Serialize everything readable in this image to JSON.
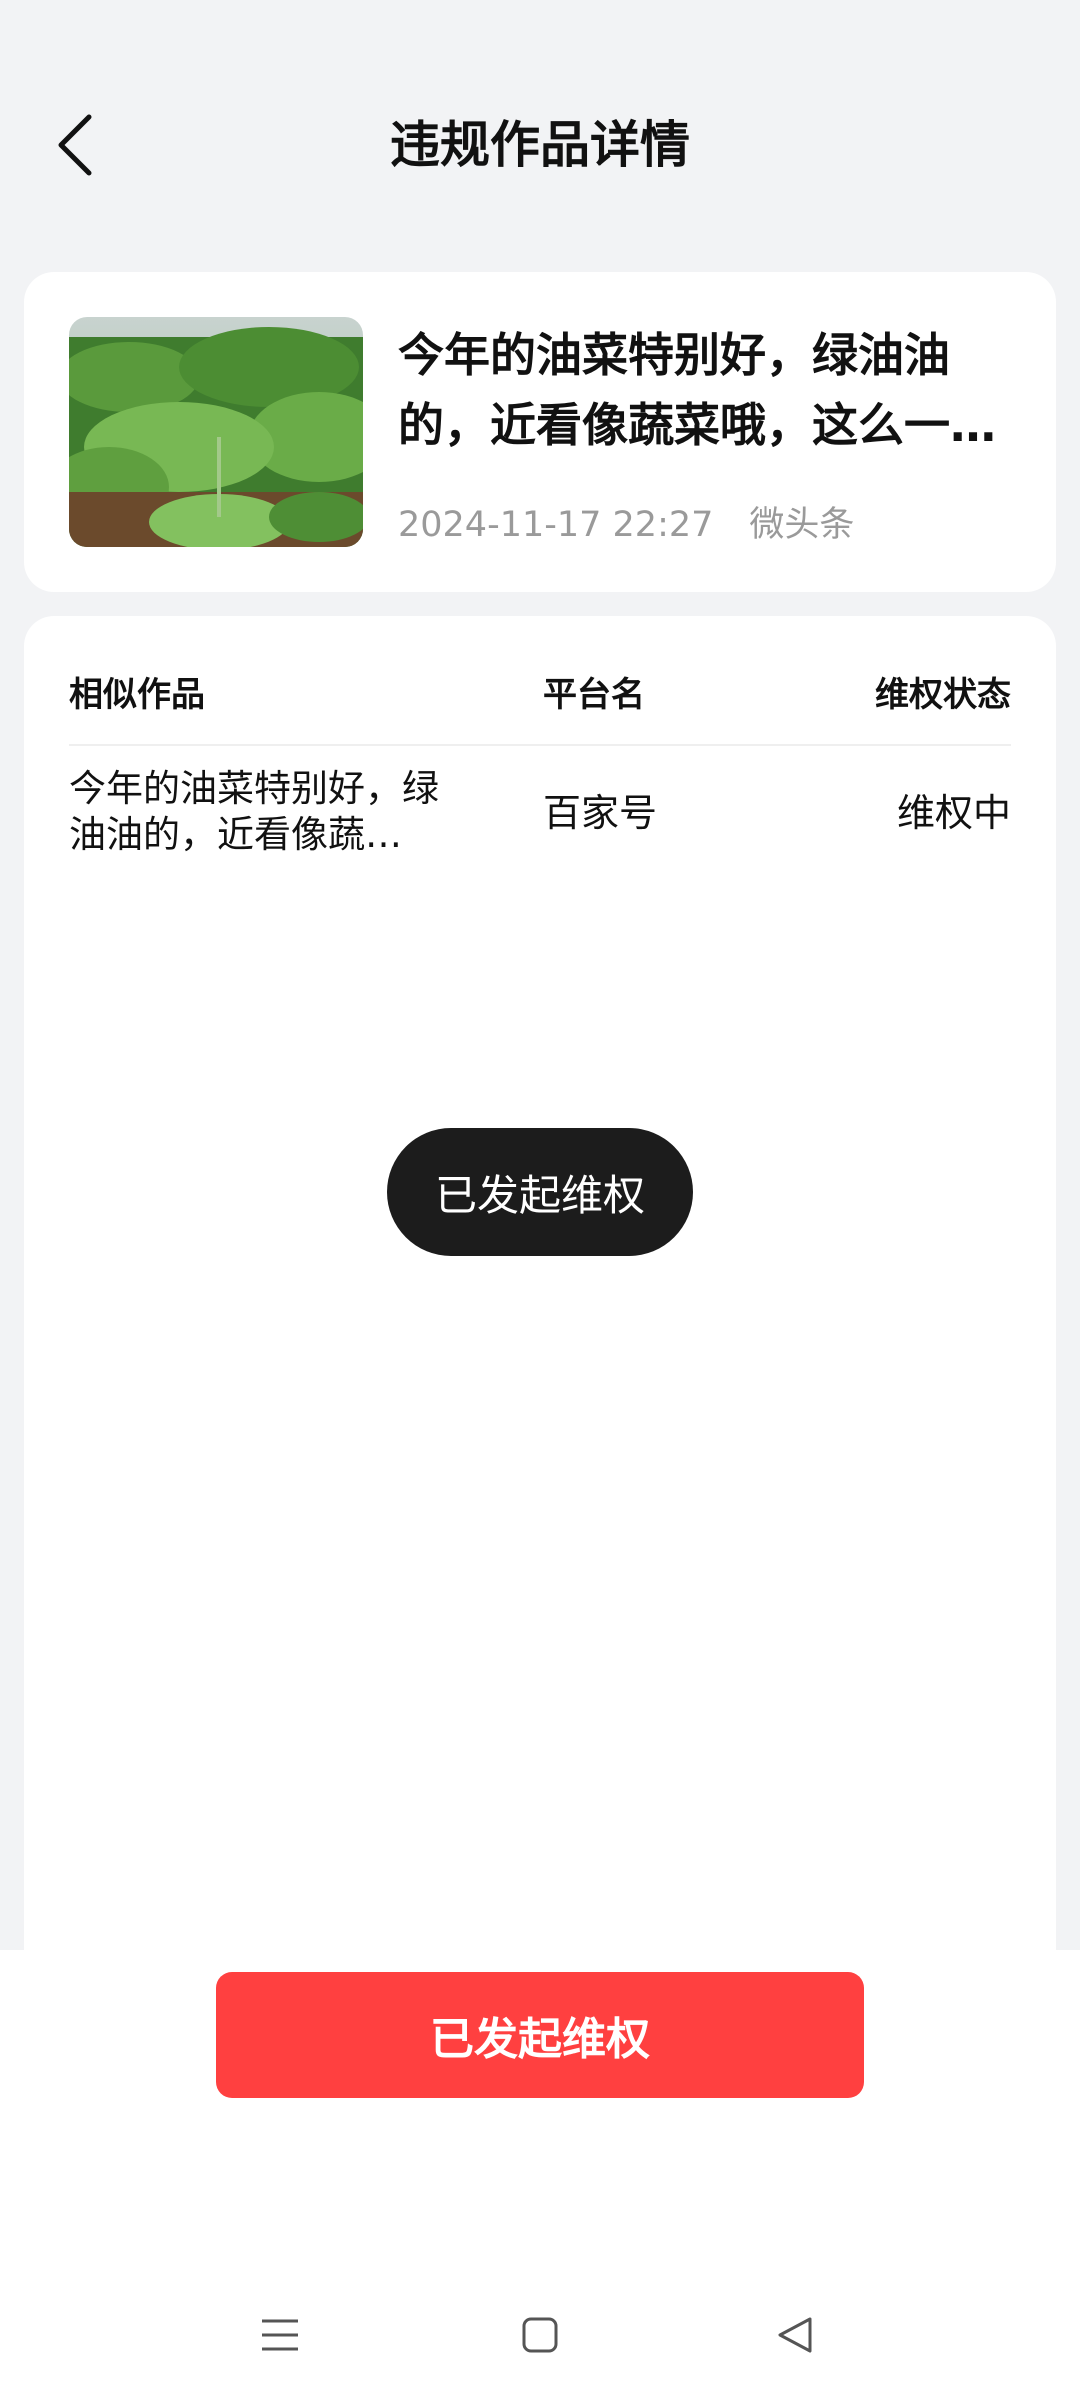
{
  "header": {
    "title": "违规作品详情",
    "back_icon": "chevron-left-icon"
  },
  "work": {
    "title": "今年的油菜特别好，绿油油的，近看像蔬菜哦，这么一…",
    "date": "2024-11-17 22:27",
    "platform": "微头条",
    "thumbnail": "rapeseed-field-photo"
  },
  "table": {
    "headers": [
      "相似作品",
      "平台名",
      "维权状态"
    ],
    "rows": [
      {
        "title": "今年的油菜特别好，绿油油的，近看像蔬…",
        "platform": "百家号",
        "status": "维权中"
      }
    ]
  },
  "toast": {
    "text": "已发起维权"
  },
  "action_button": {
    "label": "已发起维权",
    "color": "#ff4040"
  },
  "nav_bar": {
    "icons": [
      "menu-icon",
      "home-square-icon",
      "back-triangle-icon"
    ]
  }
}
